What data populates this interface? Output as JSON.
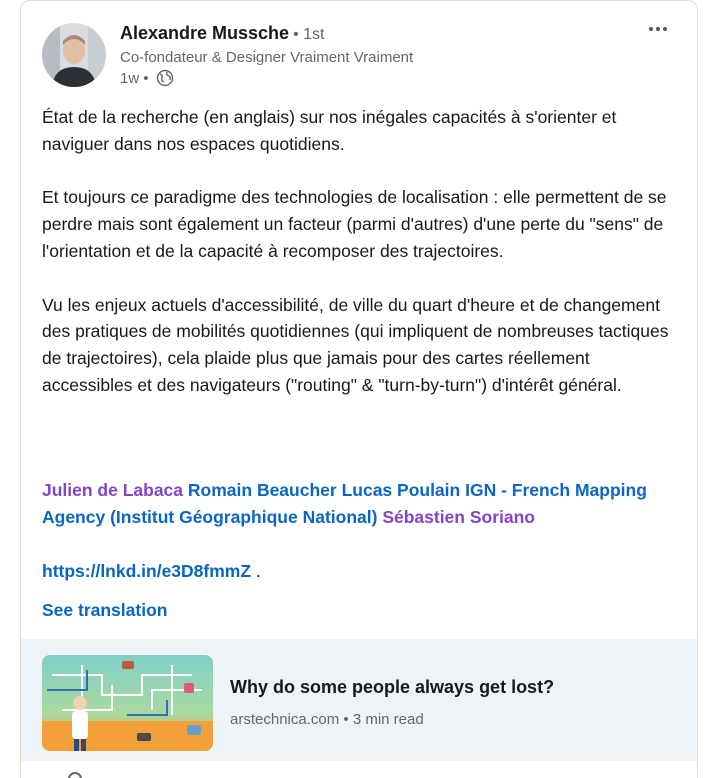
{
  "author": {
    "name": "Alexandre Mussche",
    "degree": "• 1st",
    "headline": "Co-fondateur & Designer Vraiment Vraiment",
    "time": "1w",
    "time_separator": "•",
    "visibility_icon": "globe-icon"
  },
  "menu": {
    "icon": "more-horizontal-icon"
  },
  "post": {
    "body": "État de la recherche (en anglais) sur nos inégales capacités à s'orienter et naviguer dans nos espaces quotidiens.\n\nEt toujours ce paradigme des technologies de localisation : elle permettent de se perdre mais sont également un facteur (parmi d'autres) d'une perte du \"sens\" de l'orientation et de la capacité à recomposer des trajectoires.\n\nVu les enjeux actuels d'accessibilité, de ville du quart d'heure et de changement des pratiques de mobilités quotidiennes (qui impliquent de nombreuses tactiques de trajectoires), cela plaide plus que jamais pour des cartes réellement accessibles et des navigateurs (\"routing\" & \"turn-by-turn\") d'intérêt général.",
    "mentions": [
      "Julien de Labaca",
      "Romain Beaucher",
      "Lucas Poulain",
      "IGN - French Mapping Agency (Institut Géographique National)",
      "Sébastien Soriano"
    ],
    "link": "https://lnkd.in/e3D8fmmZ",
    "link_suffix": ".",
    "see_translation": "See translation"
  },
  "article": {
    "title": "Why do some people always get lost?",
    "source": "arstechnica.com",
    "separator": "•",
    "read_time": "3 min read"
  },
  "colors": {
    "person_mention": "#8344cc",
    "company_mention": "#0a66c2",
    "link": "#0a66c2",
    "article_bg": "#eef3f8"
  }
}
